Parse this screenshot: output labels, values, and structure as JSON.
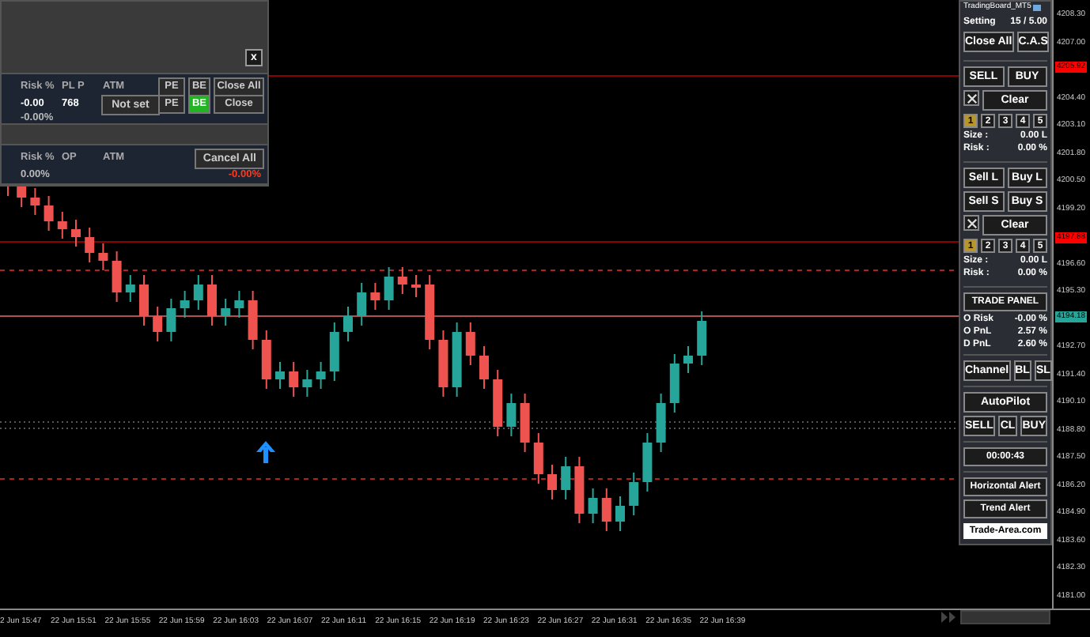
{
  "dialog": {
    "close": "x",
    "section_1": {
      "headers": [
        "Risk %",
        "PL P",
        "ATM"
      ],
      "risk": "-0.00",
      "risk_pct": "-0.00%",
      "pl_p": "768",
      "atm": "Not set",
      "buttons_top": [
        {
          "label": "PE",
          "active": false
        },
        {
          "label": "BE",
          "active": false
        },
        {
          "label": "Close All",
          "active": false
        }
      ],
      "buttons_bottom": [
        {
          "label": "PE",
          "active": false
        },
        {
          "label": "BE",
          "active": true
        },
        {
          "label": "Close",
          "active": false
        }
      ]
    },
    "section_2": {
      "headers": [
        "Risk %",
        "OP",
        "ATM"
      ],
      "risk_pct": "0.00%",
      "cancel": "Cancel All",
      "pnl": "-0.00%"
    }
  },
  "panel": {
    "title": "TradingBoard_MT5",
    "setting_label": "Setting",
    "setting_value": "15 / 5.00",
    "top_buttons": [
      "Close All",
      "C.A.S"
    ],
    "group_1": {
      "rows": [
        [
          "SELL",
          "BUY"
        ]
      ],
      "clear": "Clear",
      "levels": [
        {
          "label": "1",
          "selected": true
        },
        {
          "label": "2",
          "selected": false
        },
        {
          "label": "3",
          "selected": false
        },
        {
          "label": "4",
          "selected": false
        },
        {
          "label": "5",
          "selected": false
        }
      ],
      "size_label": "Size :",
      "size_value": "0.00 L",
      "risk_label": "Risk :",
      "risk_value": "0.00 %"
    },
    "group_2": {
      "rows": [
        [
          "Sell L",
          "Buy L"
        ],
        [
          "Sell S",
          "Buy S"
        ]
      ],
      "clear": "Clear",
      "levels": [
        {
          "label": "1",
          "selected": true
        },
        {
          "label": "2",
          "selected": false
        },
        {
          "label": "3",
          "selected": false
        },
        {
          "label": "4",
          "selected": false
        },
        {
          "label": "5",
          "selected": false
        }
      ],
      "size_label": "Size :",
      "size_value": "0.00 L",
      "risk_label": "Risk :",
      "risk_value": "0.00 %"
    },
    "trade_panel": {
      "title": "TRADE PANEL",
      "rows": [
        {
          "label": "O Risk",
          "value": "-0.00 %"
        },
        {
          "label": "O PnL",
          "value": "2.57 %"
        },
        {
          "label": "D PnL",
          "value": "2.60 %"
        }
      ]
    },
    "channel_buttons": [
      "Channel",
      "BL",
      "SL"
    ],
    "autopilot": {
      "title": "AutoPilot",
      "buttons": [
        "SELL",
        "CL",
        "BUY"
      ]
    },
    "timer": "00:00:43",
    "alerts": [
      "Horizontal Alert",
      "Trend Alert"
    ],
    "link": "Trade-Area.com"
  },
  "price_axis": [
    {
      "label": "4208.30",
      "kind": "plain"
    },
    {
      "label": "4207.00",
      "kind": "plain"
    },
    {
      "label": "4205.92",
      "kind": "badge",
      "color": "#ff0000"
    },
    {
      "label": "4204.40",
      "kind": "plain"
    },
    {
      "label": "4203.10",
      "kind": "plain"
    },
    {
      "label": "4201.80",
      "kind": "plain"
    },
    {
      "label": "4200.50",
      "kind": "plain"
    },
    {
      "label": "4199.20",
      "kind": "plain"
    },
    {
      "label": "4197.88",
      "kind": "badge",
      "color": "#ff0000"
    },
    {
      "label": "4196.60",
      "kind": "plain"
    },
    {
      "label": "4195.30",
      "kind": "plain"
    },
    {
      "label": "4194.18",
      "kind": "badge",
      "color": "#26a69a"
    },
    {
      "label": "4192.70",
      "kind": "plain"
    },
    {
      "label": "4191.40",
      "kind": "plain"
    },
    {
      "label": "4190.10",
      "kind": "plain"
    },
    {
      "label": "4188.80",
      "kind": "plain"
    },
    {
      "label": "4187.50",
      "kind": "plain"
    },
    {
      "label": "4186.20",
      "kind": "plain"
    },
    {
      "label": "4184.90",
      "kind": "plain"
    },
    {
      "label": "4183.60",
      "kind": "plain"
    },
    {
      "label": "4182.30",
      "kind": "plain"
    },
    {
      "label": "4181.00",
      "kind": "plain"
    }
  ],
  "time_axis": [
    "2 Jun 15:47",
    "22 Jun 15:51",
    "22 Jun 15:55",
    "22 Jun 15:59",
    "22 Jun 16:03",
    "22 Jun 16:07",
    "22 Jun 16:11",
    "22 Jun 16:15",
    "22 Jun 16:19",
    "22 Jun 16:23",
    "22 Jun 16:27",
    "22 Jun 16:31",
    "22 Jun 16:35",
    "22 Jun 16:39"
  ]
}
